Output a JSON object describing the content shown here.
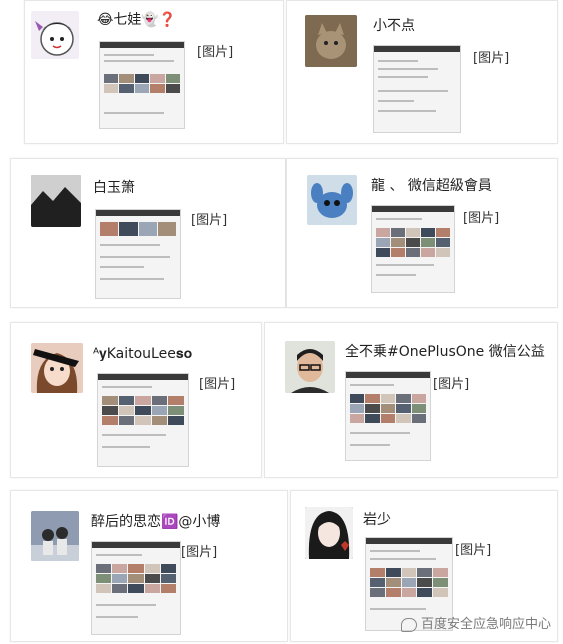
{
  "posts": [
    {
      "name": "😂七娃👻❓",
      "picture_text": "[图片]"
    },
    {
      "name": "小不点",
      "picture_text": "[图片]"
    },
    {
      "name": "白玉箫",
      "picture_text": "[图片]"
    },
    {
      "name": "龍 、 微信超級會員",
      "picture_text": "[图片]"
    },
    {
      "name": "ᴬ𝐲KaitouLee𝐬𝐨",
      "picture_text": "[图片]"
    },
    {
      "name": "全不乗#OnePlusOne 微信公益",
      "picture_text": "[图片]"
    },
    {
      "name": "醉后的思恋🆔@小博",
      "picture_text": "[图片]"
    },
    {
      "name": "岩少",
      "picture_text": "[图片]"
    }
  ],
  "watermark": {
    "text": "百度安全应急响应中心"
  }
}
